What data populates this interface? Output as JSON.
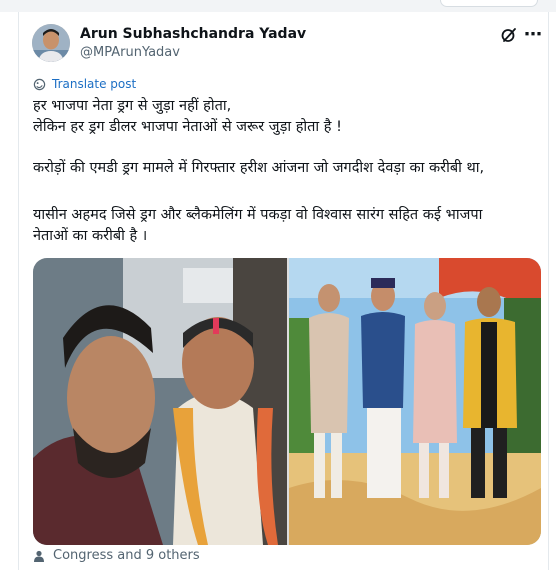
{
  "post": {
    "author_name": "Arun Subhashchandra Yadav",
    "author_handle": "@MPArunYadav",
    "translate_label": "Translate post",
    "lines": [
      "हर भाजपा नेता ड्रग से जुड़ा नहीं होता,",
      "लेकिन हर ड्रग डीलर भाजपा नेताओं से जरूर जुड़ा होता है !",
      "करोड़ों की एमडी ड्रग मामले में गिरफ्तार हरीश आंजना जो जगदीश देवड़ा का करीबी था,",
      "यासीन अहमद जिसे ड्रग और ब्लैकमेलिंग में पकड़ा वो विश्वास सारंग सहित कई भाजपा",
      "नेताओं का करीबी है ।"
    ],
    "liked_by": "Congress and 9 others"
  },
  "icons": {
    "grok": "grok-icon",
    "more": "more-options-icon",
    "translate": "globe-icon",
    "people": "person-icon"
  },
  "colors": {
    "link": "#1d6fc4",
    "secondary_text": "#536471",
    "primary_text": "#0f1419"
  }
}
